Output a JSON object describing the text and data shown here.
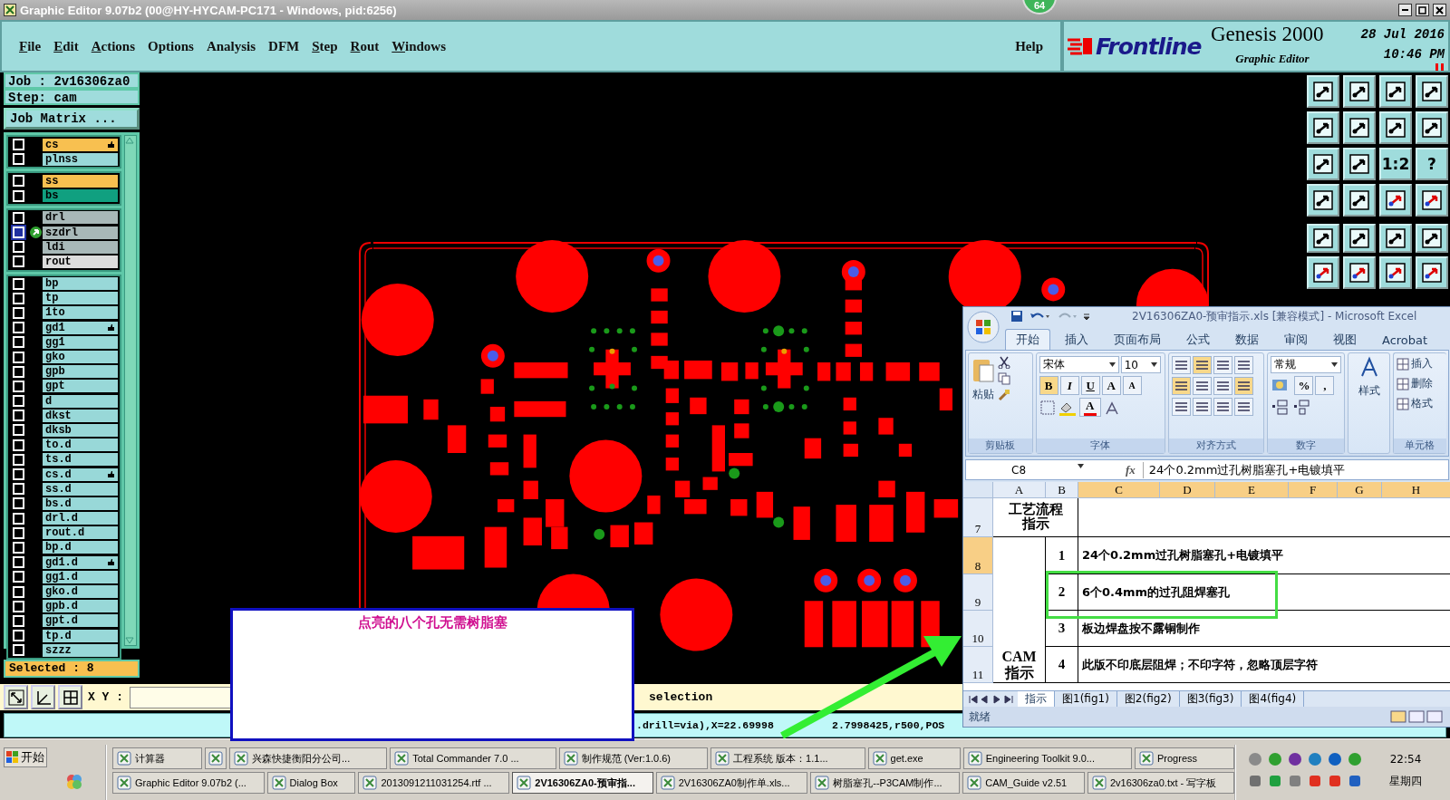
{
  "window": {
    "title": "Graphic Editor 9.07b2 (00@HY-HYCAM-PC171 - Windows, pid:6256)",
    "badge": "64"
  },
  "menu": [
    {
      "label": "File",
      "underlined": true
    },
    {
      "label": "Edit",
      "underlined": true
    },
    {
      "label": "Actions",
      "underlined": true
    },
    {
      "label": "Options",
      "underlined": false
    },
    {
      "label": "Analysis",
      "underlined": false
    },
    {
      "label": "DFM",
      "underlined": false
    },
    {
      "label": "Step",
      "underlined": true
    },
    {
      "label": "Rout",
      "underlined": true
    },
    {
      "label": "Windows",
      "underlined": true
    }
  ],
  "help": "Help",
  "brand": {
    "logo": "Frontline",
    "product": "Genesis 2000",
    "subtitle": "Graphic Editor",
    "date": "28 Jul 2016",
    "time": "10:46 PM"
  },
  "job": {
    "job": "Job : 2v16306za0",
    "step": "Step: cam",
    "matrix_button": "Job Matrix ..."
  },
  "layer_groups": [
    {
      "layers": [
        {
          "name": "cs",
          "color": "#f8c050",
          "hand": true,
          "work": false,
          "selected": false
        },
        {
          "name": "plnss",
          "color": "#98d8d8",
          "hand": false,
          "work": false,
          "selected": false
        }
      ]
    },
    {
      "layers": [
        {
          "name": "ss",
          "color": "#f8c050",
          "hand": false,
          "work": false,
          "selected": false
        },
        {
          "name": "bs",
          "color": "#10a080",
          "hand": false,
          "work": false,
          "selected": false
        }
      ]
    },
    {
      "layers": [
        {
          "name": "drl",
          "color": "#a8b8b8",
          "hand": false,
          "work": false,
          "selected": false
        },
        {
          "name": "szdrl",
          "color": "#a8b8b8",
          "hand": false,
          "work": true,
          "selected": true
        },
        {
          "name": "ldi",
          "color": "#a8b8b8",
          "hand": false,
          "work": false,
          "selected": false
        },
        {
          "name": "rout",
          "color": "#dcdcdc",
          "hand": false,
          "work": false,
          "selected": false
        }
      ]
    },
    {
      "layers": [
        {
          "name": "bp",
          "color": "#98d8d8",
          "hand": false,
          "work": false,
          "selected": false
        },
        {
          "name": "tp",
          "color": "#98d8d8",
          "hand": false,
          "work": false,
          "selected": false
        },
        {
          "name": "1to",
          "color": "#98d8d8",
          "hand": false,
          "work": false,
          "selected": false
        },
        {
          "name": "gd1",
          "color": "#98d8d8",
          "hand": true,
          "work": false,
          "selected": false
        },
        {
          "name": "gg1",
          "color": "#98d8d8",
          "hand": false,
          "work": false,
          "selected": false
        },
        {
          "name": "gko",
          "color": "#98d8d8",
          "hand": false,
          "work": false,
          "selected": false
        },
        {
          "name": "gpb",
          "color": "#98d8d8",
          "hand": false,
          "work": false,
          "selected": false
        },
        {
          "name": "gpt",
          "color": "#98d8d8",
          "hand": false,
          "work": false,
          "selected": false
        },
        {
          "name": "d",
          "color": "#98d8d8",
          "hand": false,
          "work": false,
          "selected": false
        },
        {
          "name": "dkst",
          "color": "#98d8d8",
          "hand": false,
          "work": false,
          "selected": false
        },
        {
          "name": "dksb",
          "color": "#98d8d8",
          "hand": false,
          "work": false,
          "selected": false
        },
        {
          "name": "to.d",
          "color": "#98d8d8",
          "hand": false,
          "work": false,
          "selected": false
        },
        {
          "name": "ts.d",
          "color": "#98d8d8",
          "hand": false,
          "work": false,
          "selected": false
        },
        {
          "name": "cs.d",
          "color": "#98d8d8",
          "hand": true,
          "work": false,
          "selected": false
        },
        {
          "name": "ss.d",
          "color": "#98d8d8",
          "hand": false,
          "work": false,
          "selected": false
        },
        {
          "name": "bs.d",
          "color": "#98d8d8",
          "hand": false,
          "work": false,
          "selected": false
        },
        {
          "name": "drl.d",
          "color": "#98d8d8",
          "hand": false,
          "work": false,
          "selected": false
        },
        {
          "name": "rout.d",
          "color": "#98d8d8",
          "hand": false,
          "work": false,
          "selected": false
        },
        {
          "name": "bp.d",
          "color": "#98d8d8",
          "hand": false,
          "work": false,
          "selected": false
        },
        {
          "name": "gd1.d",
          "color": "#98d8d8",
          "hand": true,
          "work": false,
          "selected": false
        },
        {
          "name": "gg1.d",
          "color": "#98d8d8",
          "hand": false,
          "work": false,
          "selected": false
        },
        {
          "name": "gko.d",
          "color": "#98d8d8",
          "hand": false,
          "work": false,
          "selected": false
        },
        {
          "name": "gpb.d",
          "color": "#98d8d8",
          "hand": false,
          "work": false,
          "selected": false
        },
        {
          "name": "gpt.d",
          "color": "#98d8d8",
          "hand": false,
          "work": false,
          "selected": false
        },
        {
          "name": "tp.d",
          "color": "#98d8d8",
          "hand": false,
          "work": false,
          "selected": false
        },
        {
          "name": "szzz",
          "color": "#98d8d8",
          "hand": false,
          "work": false,
          "selected": false
        }
      ]
    }
  ],
  "selected_count": "Selected : 8",
  "coords_label": "X Y :",
  "selection_text": "selection",
  "status": [
    ".drill=via),X=22.69998",
    "2.7998425,r500,POS"
  ],
  "annotation": "点亮的八个孔无需树脂塞",
  "toolbar": [
    {
      "kind": "icon"
    },
    {
      "kind": "icon"
    },
    {
      "kind": "icon"
    },
    {
      "kind": "icon"
    },
    {
      "kind": "icon"
    },
    {
      "kind": "icon"
    },
    {
      "kind": "icon"
    },
    {
      "kind": "icon"
    },
    {
      "kind": "icon"
    },
    {
      "kind": "icon"
    },
    {
      "kind": "text",
      "label": "1:2"
    },
    {
      "kind": "text",
      "label": "?"
    },
    {
      "kind": "icon"
    },
    {
      "kind": "icon"
    },
    {
      "kind": "icon"
    },
    {
      "kind": "icon"
    },
    {
      "kind": "icon"
    },
    {
      "kind": "icon"
    },
    {
      "kind": "icon"
    },
    {
      "kind": "icon"
    },
    {
      "kind": "icon"
    },
    {
      "kind": "icon"
    },
    {
      "kind": "icon"
    },
    {
      "kind": "icon"
    }
  ],
  "excel": {
    "title": "2V16306ZA0-预审指示.xls  [兼容模式] - Microsoft Excel",
    "tabs": [
      {
        "label": "开始",
        "selected": true
      },
      {
        "label": "插入",
        "selected": false
      },
      {
        "label": "页面布局",
        "selected": false
      },
      {
        "label": "公式",
        "selected": false
      },
      {
        "label": "数据",
        "selected": false
      },
      {
        "label": "审阅",
        "selected": false
      },
      {
        "label": "视图",
        "selected": false
      },
      {
        "label": "Acrobat",
        "selected": false
      }
    ],
    "clipboard": {
      "paste": "粘贴",
      "label": "剪贴板"
    },
    "font": {
      "name": "宋体",
      "size": "10",
      "buttons": [
        "B",
        "I",
        "U",
        "A",
        "A"
      ],
      "color_button": "A",
      "label": "字体"
    },
    "alignment": {
      "label": "对齐方式"
    },
    "number": {
      "format": "常规",
      "percent": "%",
      "comma": ",",
      "label": "数字"
    },
    "styles": {
      "label": "样式"
    },
    "cells": {
      "items": [
        "插入",
        "删除",
        "格式"
      ],
      "label": "单元格"
    },
    "name_box": "C8",
    "fx": "fx",
    "formula": "24个0.2mm过孔树脂塞孔+电镀填平",
    "columns": [
      {
        "label": "A",
        "selected": false
      },
      {
        "label": "B",
        "selected": false
      },
      {
        "label": "C",
        "selected": true
      },
      {
        "label": "D",
        "selected": true
      },
      {
        "label": "E",
        "selected": true
      },
      {
        "label": "F",
        "selected": true
      },
      {
        "label": "G",
        "selected": true
      },
      {
        "label": "H",
        "selected": true
      }
    ],
    "rows": [
      {
        "number": "7",
        "selected": false,
        "a": "工艺流程指示"
      },
      {
        "number": "8",
        "selected": true,
        "b": "1",
        "c": "24个0.2mm过孔树脂塞孔+电镀填平"
      },
      {
        "number": "9",
        "selected": false,
        "b": "2",
        "c": "6个0.4mm的过孔阻焊塞孔"
      },
      {
        "number": "10",
        "selected": false,
        "b": "3",
        "c": "板边焊盘按不露铜制作"
      },
      {
        "number": "11",
        "selected": false,
        "a": "CAM指示",
        "b": "4",
        "c": "此版不印底层阻焊；不印字符，忽略顶层字符"
      }
    ],
    "sheet_tabs": [
      {
        "label": "指示",
        "selected": true
      },
      {
        "label": "图1(fig1)",
        "selected": false
      },
      {
        "label": "图2(fig2)",
        "selected": false
      },
      {
        "label": "图3(fig3)",
        "selected": false
      },
      {
        "label": "图4(fig4)",
        "selected": false
      }
    ],
    "status": "就绪"
  },
  "taskbar": {
    "start": "开始",
    "row1": [
      {
        "label": "计算器",
        "selected": false
      },
      {
        "selected": false
      },
      {
        "label": "兴森快捷衡阳分公司...",
        "selected": false
      },
      {
        "label": "Total Commander 7.0 ...",
        "selected": false
      },
      {
        "label": "制作规范 (Ver:1.0.6)",
        "selected": false
      },
      {
        "label": "工程系统  版本：1.1...",
        "selected": false
      },
      {
        "label": "get.exe",
        "selected": false
      },
      {
        "label": "Engineering Toolkit 9.0...",
        "selected": false
      },
      {
        "label": "Progress",
        "selected": false
      }
    ],
    "row2": [
      {
        "label": "Graphic Editor 9.07b2 (...",
        "selected": false
      },
      {
        "label": "Dialog Box",
        "selected": false
      },
      {
        "label": "2013091211031254.rtf ...",
        "selected": false
      },
      {
        "label": "2V16306ZA0-预审指...",
        "selected": true
      },
      {
        "label": "2V16306ZA0制作单.xls...",
        "selected": false
      },
      {
        "label": "树脂塞孔--P3CAM制作...",
        "selected": false
      },
      {
        "label": "CAM_Guide v2.51",
        "selected": false
      },
      {
        "label": "2v16306za0.txt - 写字板",
        "selected": false
      }
    ],
    "time": "22:54",
    "day": "星期四"
  }
}
